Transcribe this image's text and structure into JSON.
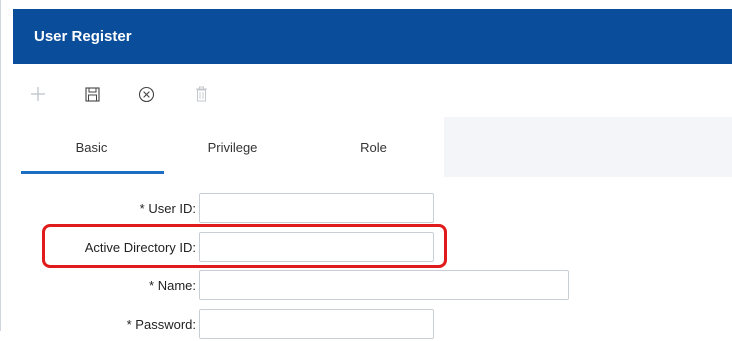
{
  "header": {
    "title": "User Register"
  },
  "toolbar": {
    "buttons": [
      {
        "icon": "plus-icon",
        "state": "disabled"
      },
      {
        "icon": "save-icon",
        "state": "enabled"
      },
      {
        "icon": "cancel-icon",
        "state": "enabled"
      },
      {
        "icon": "trash-icon",
        "state": "disabled"
      }
    ]
  },
  "tabs": [
    {
      "label": "Basic",
      "active": true
    },
    {
      "label": "Privilege",
      "active": false
    },
    {
      "label": "Role",
      "active": false
    }
  ],
  "form": {
    "user_id": {
      "label": "* User ID:",
      "value": ""
    },
    "ad_id": {
      "label": "Active Directory ID:",
      "value": ""
    },
    "name": {
      "label": "* Name:",
      "value": ""
    },
    "password": {
      "label": "* Password:",
      "value": ""
    }
  },
  "colors": {
    "header_bg": "#0a4d9b",
    "tab_accent": "#1b6ec2",
    "highlight": "#e01b1b"
  }
}
